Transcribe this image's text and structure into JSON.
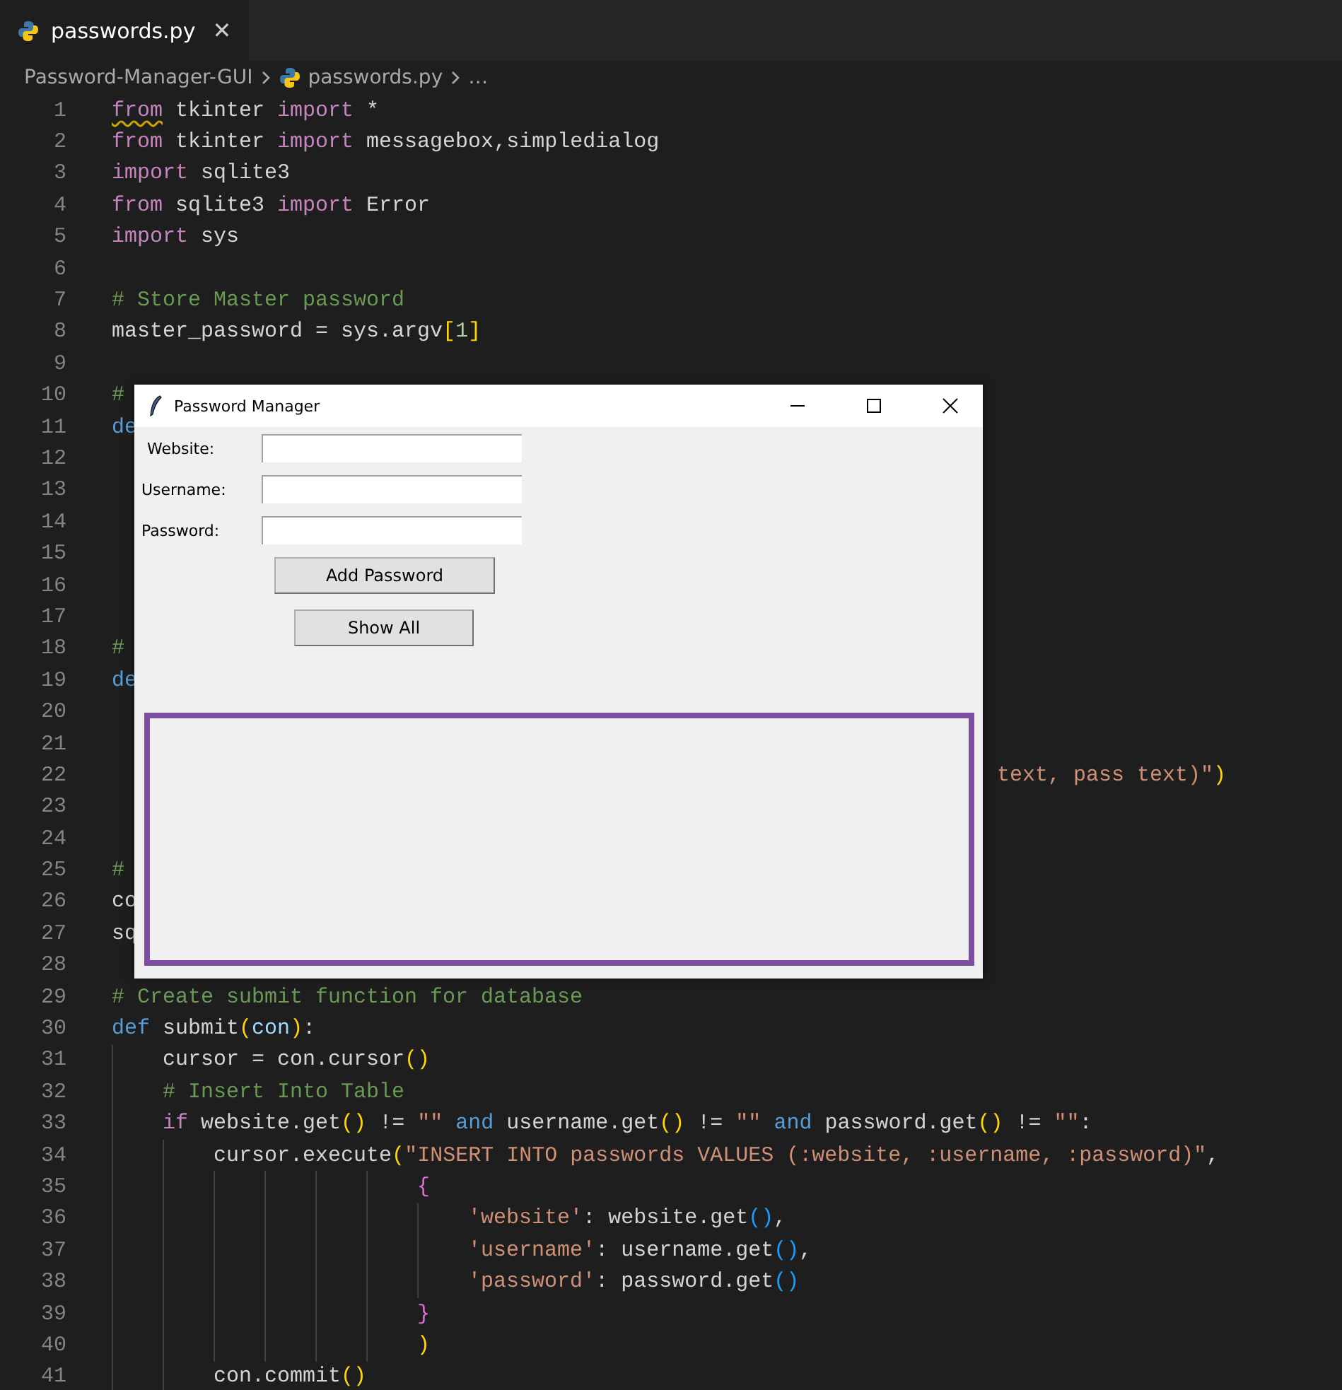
{
  "tab": {
    "label": "passwords.py",
    "selected": true,
    "close": "✕"
  },
  "breadcrumb": {
    "folder": "Password-Manager-GUI",
    "file": "passwords.py",
    "more": "…"
  },
  "code_lines": [
    {
      "number": "1",
      "tokens": [
        {
          "kind": "kw-warn",
          "text": "from"
        },
        {
          "kind": "id",
          "text": " tkinter "
        },
        {
          "kind": "kw",
          "text": "import"
        },
        {
          "kind": "id",
          "text": " *"
        }
      ]
    },
    {
      "number": "2",
      "tokens": [
        {
          "kind": "kw",
          "text": "from"
        },
        {
          "kind": "id",
          "text": " tkinter "
        },
        {
          "kind": "kw",
          "text": "import"
        },
        {
          "kind": "id",
          "text": " messagebox,simpledialog"
        }
      ]
    },
    {
      "number": "3",
      "tokens": [
        {
          "kind": "kw",
          "text": "import"
        },
        {
          "kind": "id",
          "text": " sqlite3"
        }
      ]
    },
    {
      "number": "4",
      "tokens": [
        {
          "kind": "kw",
          "text": "from"
        },
        {
          "kind": "id",
          "text": " sqlite3 "
        },
        {
          "kind": "kw",
          "text": "import"
        },
        {
          "kind": "id",
          "text": " Error"
        }
      ]
    },
    {
      "number": "5",
      "tokens": [
        {
          "kind": "kw",
          "text": "import"
        },
        {
          "kind": "id",
          "text": " sys"
        }
      ]
    },
    {
      "number": "6"
    },
    {
      "number": "7",
      "tokens": [
        {
          "kind": "comment",
          "text": "# Store Master password"
        }
      ]
    },
    {
      "number": "8",
      "tokens": [
        {
          "kind": "id",
          "text": "master_password = sys.argv"
        },
        {
          "kind": "br1",
          "text": "["
        },
        {
          "kind": "num",
          "text": "1"
        },
        {
          "kind": "br1",
          "text": "]"
        }
      ]
    },
    {
      "number": "9"
    },
    {
      "number": "10",
      "tokens": [
        {
          "kind": "comment",
          "text": "#"
        }
      ]
    },
    {
      "number": "11",
      "tokens": [
        {
          "kind": "def",
          "text": "de"
        }
      ]
    },
    {
      "number": "12"
    },
    {
      "number": "13"
    },
    {
      "number": "14"
    },
    {
      "number": "15"
    },
    {
      "number": "16"
    },
    {
      "number": "17"
    },
    {
      "number": "18",
      "tokens": [
        {
          "kind": "comment",
          "text": "#"
        }
      ]
    },
    {
      "number": "19",
      "tokens": [
        {
          "kind": "def",
          "text": "de"
        }
      ]
    },
    {
      "number": "20"
    },
    {
      "number": "21"
    },
    {
      "number": "22",
      "tokens": [
        {
          "kind": "tail-str",
          "text": "text, pass text)\""
        },
        {
          "kind": "br1",
          "text": ")"
        }
      ]
    },
    {
      "number": "23"
    },
    {
      "number": "24"
    },
    {
      "number": "25",
      "tokens": [
        {
          "kind": "comment",
          "text": "#"
        }
      ]
    },
    {
      "number": "26",
      "tokens": [
        {
          "kind": "id",
          "text": "co"
        }
      ]
    },
    {
      "number": "27",
      "tokens": [
        {
          "kind": "id",
          "text": "sq"
        }
      ]
    },
    {
      "number": "28"
    },
    {
      "number": "29",
      "tokens": [
        {
          "kind": "comment",
          "text": "# Create submit function for database"
        }
      ]
    },
    {
      "number": "30",
      "tokens": [
        {
          "kind": "def",
          "text": "def"
        },
        {
          "kind": "id",
          "text": " submit"
        },
        {
          "kind": "br1",
          "text": "("
        },
        {
          "kind": "param",
          "text": "con"
        },
        {
          "kind": "br1",
          "text": ")"
        },
        {
          "kind": "id",
          "text": ":"
        }
      ]
    },
    {
      "number": "31",
      "tokens": [
        {
          "kind": "id",
          "text": "    cursor = con.cursor"
        },
        {
          "kind": "br1",
          "text": "()"
        }
      ]
    },
    {
      "number": "32",
      "tokens": [
        {
          "kind": "comment",
          "text": "    # Insert Into Table"
        }
      ]
    },
    {
      "number": "33",
      "tokens": [
        {
          "kind": "kw",
          "text": "    if"
        },
        {
          "kind": "id",
          "text": " website.get"
        },
        {
          "kind": "br1",
          "text": "()"
        },
        {
          "kind": "id",
          "text": " != "
        },
        {
          "kind": "str",
          "text": "\"\""
        },
        {
          "kind": "def",
          "text": " and"
        },
        {
          "kind": "id",
          "text": " username.get"
        },
        {
          "kind": "br1",
          "text": "()"
        },
        {
          "kind": "id",
          "text": " != "
        },
        {
          "kind": "str",
          "text": "\"\""
        },
        {
          "kind": "def",
          "text": " and"
        },
        {
          "kind": "id",
          "text": " password.get"
        },
        {
          "kind": "br1",
          "text": "()"
        },
        {
          "kind": "id",
          "text": " != "
        },
        {
          "kind": "str",
          "text": "\"\""
        },
        {
          "kind": "id",
          "text": ":"
        }
      ]
    },
    {
      "number": "34",
      "tokens": [
        {
          "kind": "id",
          "text": "        cursor.execute"
        },
        {
          "kind": "br1",
          "text": "("
        },
        {
          "kind": "str",
          "text": "\"INSERT INTO passwords VALUES (:website, :username, :password)\""
        },
        {
          "kind": "id",
          "text": ","
        }
      ]
    },
    {
      "number": "35",
      "tokens": [
        {
          "kind": "br2",
          "text": "                        {"
        }
      ]
    },
    {
      "number": "36",
      "tokens": [
        {
          "kind": "str",
          "text": "                            'website'"
        },
        {
          "kind": "id",
          "text": ": website.get"
        },
        {
          "kind": "br3",
          "text": "()"
        },
        {
          "kind": "id",
          "text": ","
        }
      ]
    },
    {
      "number": "37",
      "tokens": [
        {
          "kind": "str",
          "text": "                            'username'"
        },
        {
          "kind": "id",
          "text": ": username.get"
        },
        {
          "kind": "br3",
          "text": "()"
        },
        {
          "kind": "id",
          "text": ","
        }
      ]
    },
    {
      "number": "38",
      "tokens": [
        {
          "kind": "str",
          "text": "                            'password'"
        },
        {
          "kind": "id",
          "text": ": password.get"
        },
        {
          "kind": "br3",
          "text": "()"
        }
      ]
    },
    {
      "number": "39",
      "tokens": [
        {
          "kind": "br2",
          "text": "                        }"
        }
      ]
    },
    {
      "number": "40",
      "tokens": [
        {
          "kind": "br1",
          "text": "                        )"
        }
      ]
    },
    {
      "number": "41",
      "tokens": [
        {
          "kind": "id",
          "text": "        con.commit"
        },
        {
          "kind": "br1",
          "text": "()"
        }
      ]
    }
  ],
  "dialog": {
    "title": "Password Manager",
    "fields": [
      {
        "label": "Website:"
      },
      {
        "label": "Username:"
      },
      {
        "label": "Password:"
      }
    ],
    "buttons": [
      {
        "label": "Add Password"
      },
      {
        "label": "Show All"
      }
    ]
  }
}
